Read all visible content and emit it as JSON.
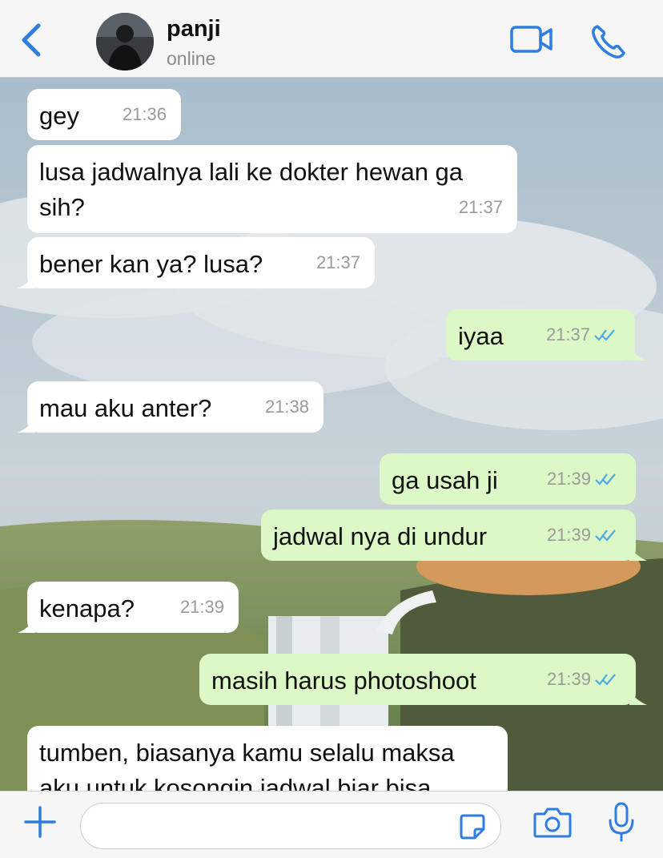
{
  "header": {
    "contact_name": "panji",
    "status": "online"
  },
  "input": {
    "placeholder": ""
  },
  "colors": {
    "accent": "#2f7de1",
    "incoming_bubble": "#ffffff",
    "outgoing_bubble": "#dcf8c6",
    "read_ticks": "#4fa9e8"
  },
  "messages": [
    {
      "direction": "in",
      "text": "gey",
      "time": "21:36"
    },
    {
      "direction": "in",
      "text": "lusa jadwalnya lali ke dokter hewan ga sih?",
      "time": "21:37"
    },
    {
      "direction": "in",
      "text": "bener kan ya? lusa?",
      "time": "21:37"
    },
    {
      "direction": "out",
      "text": "iyaa",
      "time": "21:37",
      "read": true
    },
    {
      "direction": "in",
      "text": "mau aku anter?",
      "time": "21:38"
    },
    {
      "direction": "out",
      "text": "ga usah ji",
      "time": "21:39",
      "read": true
    },
    {
      "direction": "out",
      "text": "jadwal nya di undur",
      "time": "21:39",
      "read": true
    },
    {
      "direction": "in",
      "text": "kenapa?",
      "time": "21:39"
    },
    {
      "direction": "out",
      "text": "masih harus photoshoot",
      "time": "21:39",
      "read": true
    },
    {
      "direction": "in",
      "text": "tumben, biasanya kamu selalu maksa aku untuk kosongin jadwal biar bisa",
      "time": ""
    }
  ]
}
